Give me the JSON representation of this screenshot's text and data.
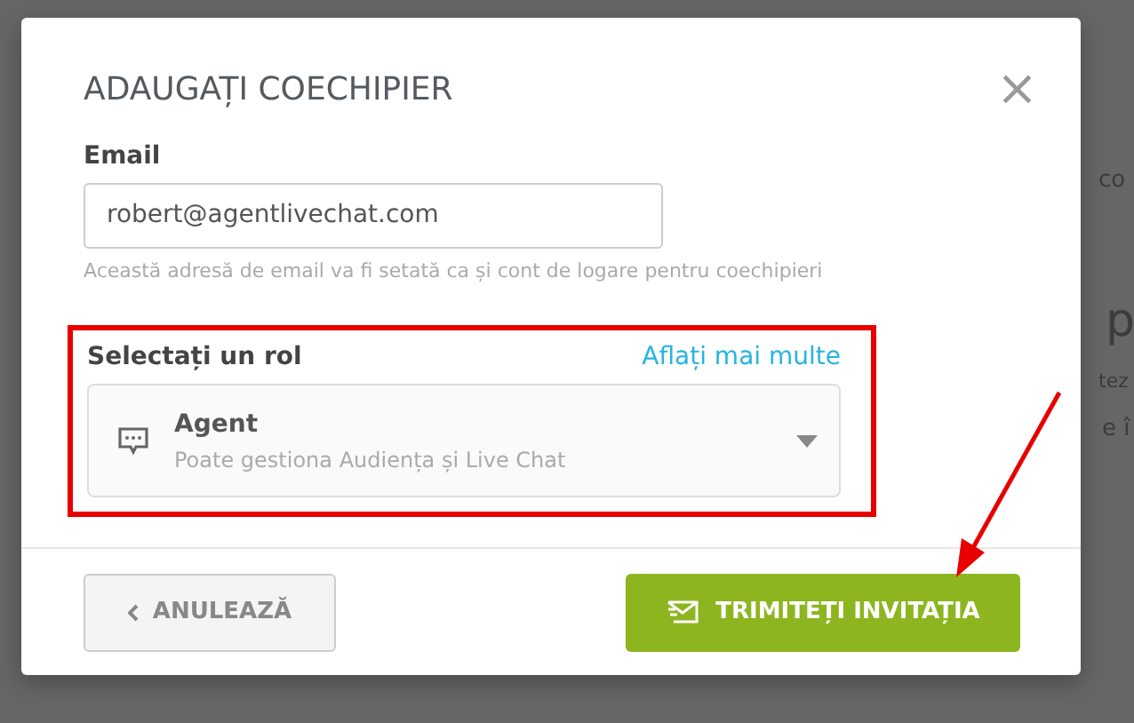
{
  "background_fragments": [
    "co",
    "p",
    "tez",
    "e î"
  ],
  "dialog": {
    "title": "ADAUGAȚI COECHIPIER",
    "close": "×",
    "email": {
      "label": "Email",
      "value": "robert@agentlivechat.com",
      "help": "Această adresă de email va fi setată ca și cont de logare pentru coechipieri"
    },
    "role": {
      "label": "Selectați un rol",
      "link": "Aflați mai multe",
      "name": "Agent",
      "description": "Poate gestiona Audiența și Live Chat",
      "highlighted": true
    },
    "buttons": [
      {
        "kind": "cancel",
        "label": "ANULEAZĂ"
      },
      {
        "kind": "send",
        "label": "TRIMITEȚI INVITAȚIA"
      }
    ]
  }
}
